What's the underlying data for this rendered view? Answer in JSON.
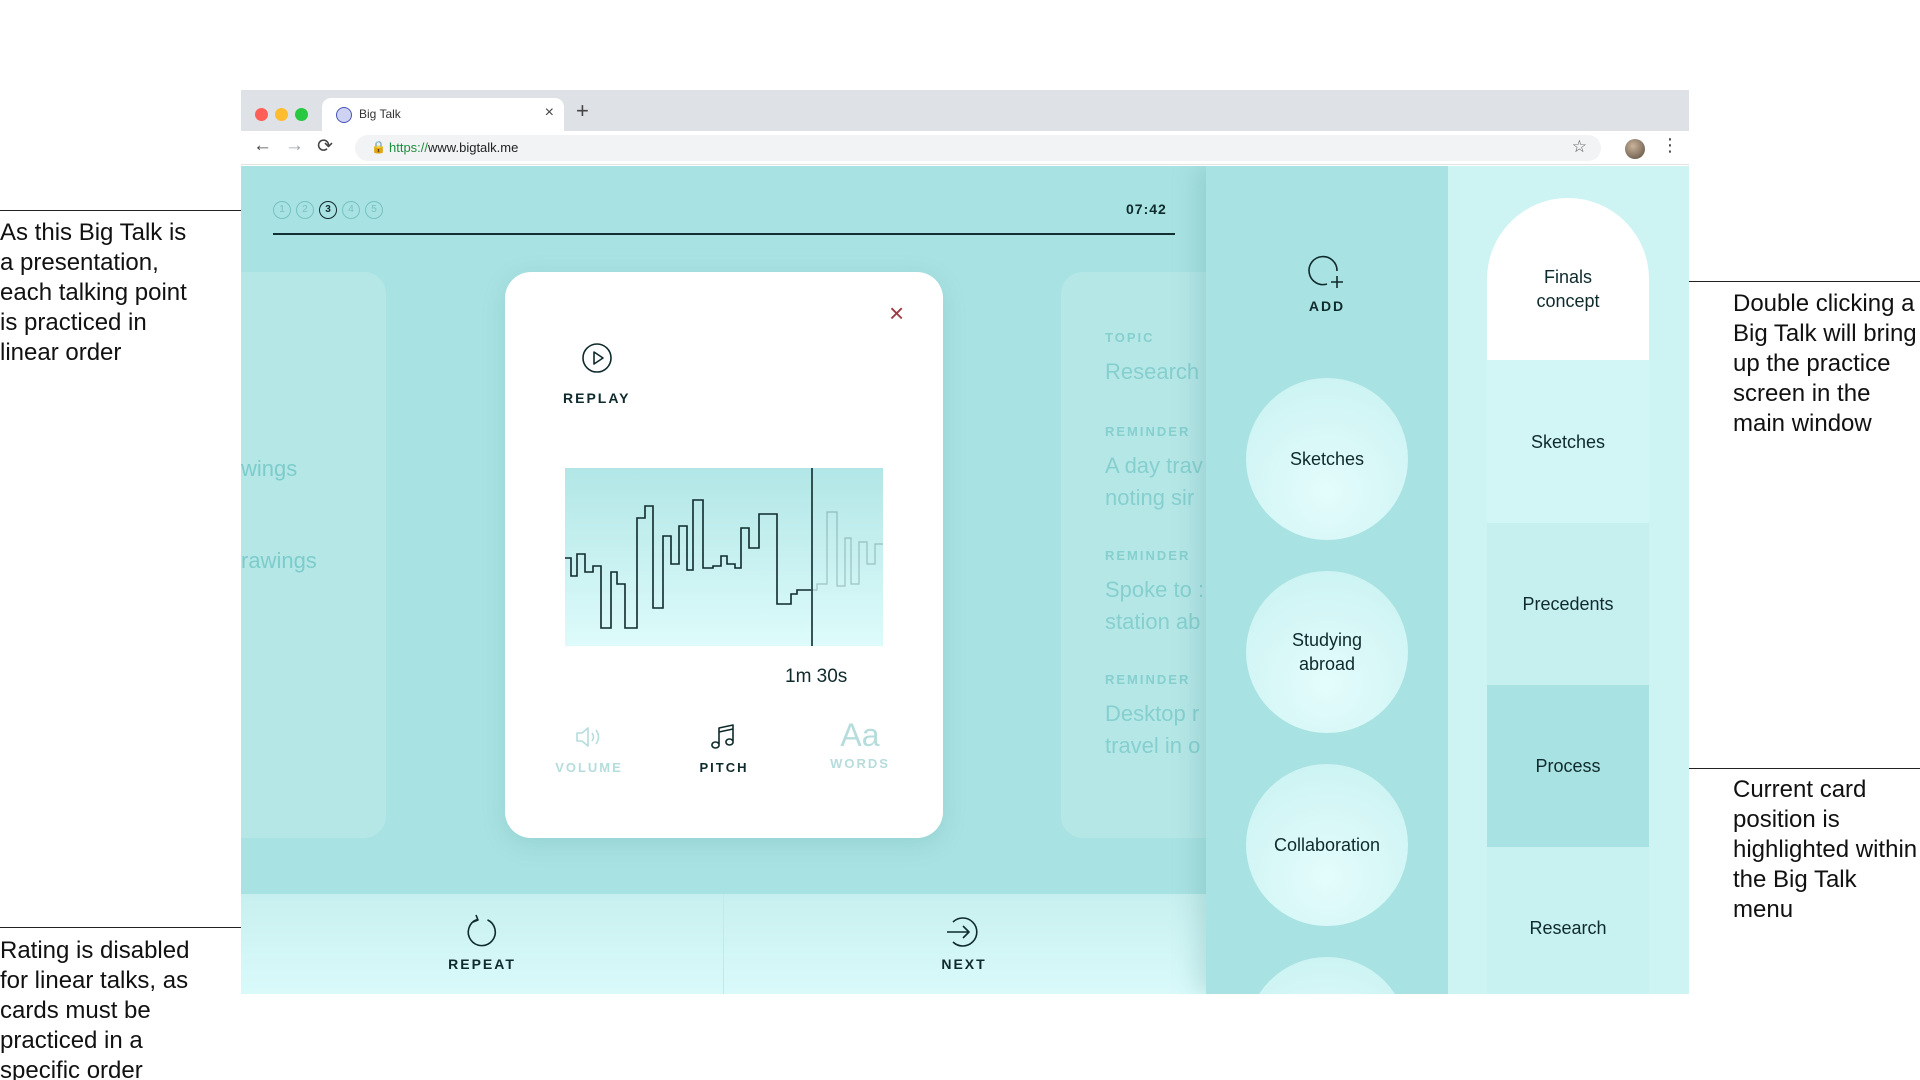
{
  "annotations": {
    "top_left": "As this Big Talk is\na presentation,\neach talking point\nis practiced in\nlinear order",
    "bottom_left": "Rating is disabled\nfor linear talks, as\ncards must be\npracticed in a\nspecific order",
    "top_right": "Double clicking a\nBig Talk will bring\nup the practice\nscreen in the\nmain window",
    "bottom_right": "Current card\nposition is\nhighlighted within\nthe Big Talk menu"
  },
  "browser": {
    "tab_title": "Big Talk",
    "tab_close": "×",
    "new_tab": "+",
    "back": "←",
    "forward": "→",
    "reload": "⟳",
    "lock": "🔒",
    "url_protocol": "https://",
    "url_host": "www.bigtalk.me",
    "star": "☆",
    "menu": "⋮",
    "colors": {
      "close": "#ff5f57",
      "minimize": "#febc2e",
      "maximize": "#28c840"
    }
  },
  "practice": {
    "steps": [
      {
        "label": "1",
        "active": false
      },
      {
        "label": "2",
        "active": false
      },
      {
        "label": "3",
        "active": true
      },
      {
        "label": "4",
        "active": false
      },
      {
        "label": "5",
        "active": false
      }
    ],
    "timer": "07:42",
    "progress": 1.0,
    "left_card": {
      "line1": "wings",
      "line2": "rawings"
    },
    "card": {
      "close": "×",
      "replay_label": "REPLAY",
      "duration": "1m 30s",
      "modes": [
        {
          "label": "VOLUME",
          "icon": "speaker-icon",
          "active": false
        },
        {
          "label": "PITCH",
          "icon": "music-note-icon",
          "active": true
        },
        {
          "label": "WORDS",
          "icon": "text-size-icon",
          "glyph": "Aa",
          "active": false
        }
      ]
    },
    "right_card": {
      "topic_label": "TOPIC",
      "topic_text": "Research",
      "reminders": [
        {
          "label": "REMINDER",
          "line1": "A day trav",
          "line2": "noting sir"
        },
        {
          "label": "REMINDER",
          "line1": "Spoke to :",
          "line2": "station ab"
        },
        {
          "label": "REMINDER",
          "line1": "Desktop r",
          "line2": "travel in o"
        }
      ]
    },
    "bottom": {
      "repeat_label": "REPEAT",
      "next_label": "NEXT"
    }
  },
  "circles": {
    "add_label": "ADD",
    "items": [
      "Sketches",
      "Studying\nabroad",
      "Collaboration"
    ]
  },
  "menu": {
    "items": [
      {
        "label": "Finals\nconcept",
        "current": false
      },
      {
        "label": "Sketches",
        "current": false
      },
      {
        "label": "Precedents",
        "current": false
      },
      {
        "label": "Process",
        "current": true
      },
      {
        "label": "Research",
        "current": false
      }
    ]
  },
  "theme": {
    "teal": "#a9e2e2",
    "teal_light": "#cdf3f3",
    "teal_highlight": "#a9e2e2",
    "ink": "#0f2a2c",
    "accent_close": "#9b3b44"
  }
}
